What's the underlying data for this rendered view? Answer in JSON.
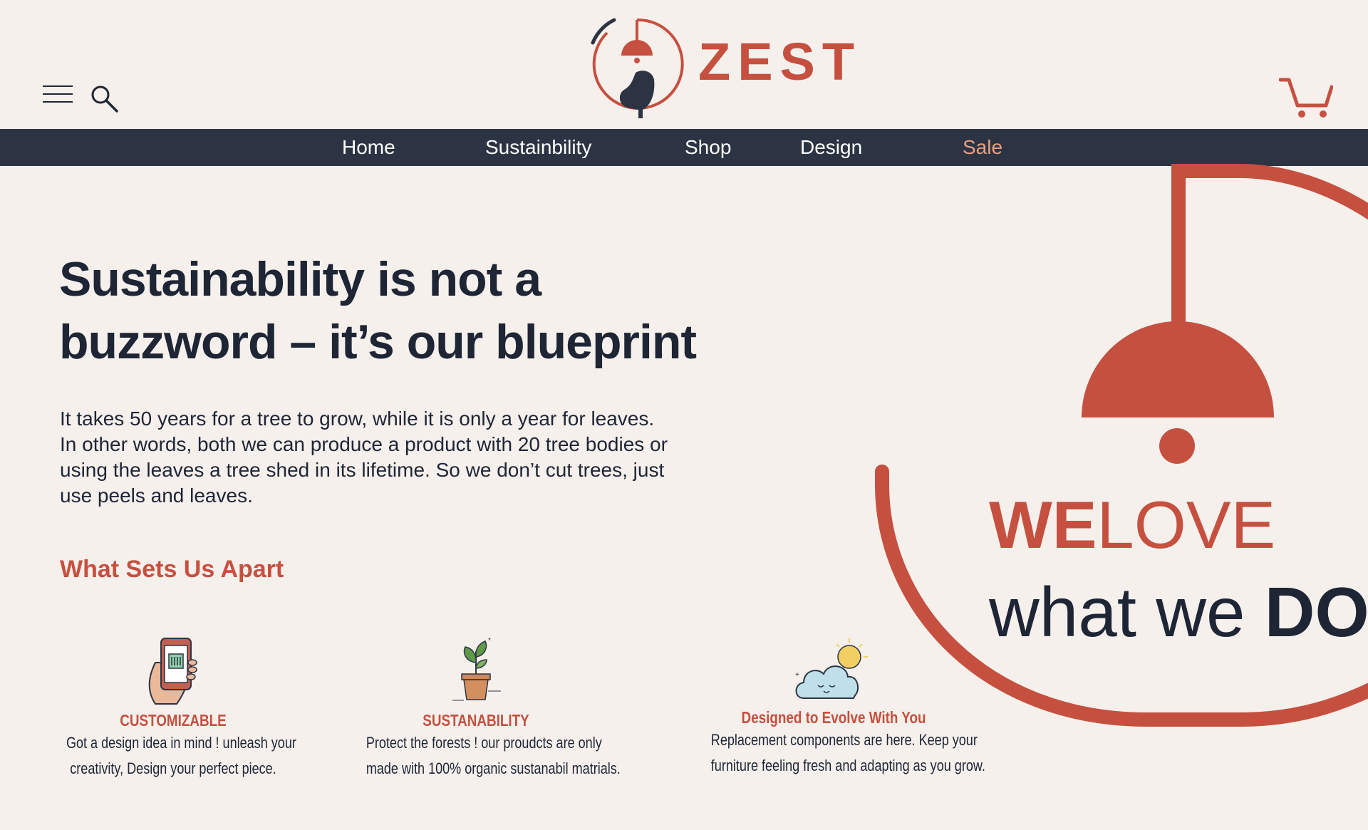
{
  "brand": {
    "name": "ZEST",
    "accent": "#c65040",
    "dark": "#2c3444"
  },
  "header": {
    "menu_icon": "hamburger-icon",
    "search_icon": "search-icon",
    "cart_icon": "cart-icon"
  },
  "nav": {
    "items": [
      {
        "label": "Home"
      },
      {
        "label": "Sustainbility"
      },
      {
        "label": "Shop"
      },
      {
        "label": "Design"
      },
      {
        "label": "Sale"
      }
    ]
  },
  "hero": {
    "title_line1": "Sustainability is not a",
    "title_line2": "buzzword – it’s our blueprint",
    "text": "It takes 50 years for a tree to grow, while it is only a year for leaves. In other words, both we can produce a product with 20 tree bodies or using the leaves a tree shed in its lifetime. So we don’t cut trees, just use peels and leaves.",
    "apart_title": "What Sets Us Apart"
  },
  "features": [
    {
      "icon": "phone-hand-icon",
      "title": "CUSTOMIZABLE",
      "line1": "Got a design idea in mind ! unleash your",
      "line2": "creativity, Design your perfect piece."
    },
    {
      "icon": "plant-pot-icon",
      "title": "SUSTANABILITY",
      "line1": "Protect the forests ! our proudcts are only",
      "line2": "made with 100% organic sustanabil matrials."
    },
    {
      "icon": "cloud-sun-icon",
      "title": "Designed to Evolve With You",
      "line1": "Replacement components are here. Keep your",
      "line2": "furniture feeling fresh and adapting as you grow."
    }
  ],
  "slogan": {
    "we": "WE",
    "love": "LOVE",
    "what_we": "what we ",
    "do": "DO"
  }
}
